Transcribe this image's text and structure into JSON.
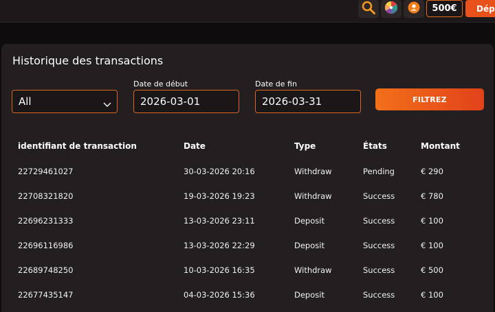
{
  "topbar": {
    "balance": "500€",
    "deposit_label": "Dépôt"
  },
  "panel": {
    "title": "Historique des transactions"
  },
  "filters": {
    "type_selected": "All",
    "start_label": "Date de début",
    "start_value": "2026-03-01",
    "end_label": "Date de fin",
    "end_value": "2026-03-31",
    "button_label": "FILTREZ"
  },
  "table": {
    "headers": [
      "identifiant de transaction",
      "Date",
      "Type",
      "États",
      "Montant"
    ],
    "rows": [
      [
        "22729461027",
        "30-03-2026 20:16",
        "Withdraw",
        "Pending",
        "€ 290"
      ],
      [
        "22708321820",
        "19-03-2026 19:23",
        "Withdraw",
        "Success",
        "€ 780"
      ],
      [
        "22696231333",
        "13-03-2026 23:11",
        "Deposit",
        "Success",
        "€ 100"
      ],
      [
        "22696116986",
        "13-03-2026 22:29",
        "Deposit",
        "Success",
        "€ 100"
      ],
      [
        "22689748250",
        "10-03-2026 16:35",
        "Withdraw",
        "Success",
        "€ 500"
      ],
      [
        "22677435147",
        "04-03-2026 15:36",
        "Deposit",
        "Success",
        "€ 100"
      ]
    ]
  }
}
